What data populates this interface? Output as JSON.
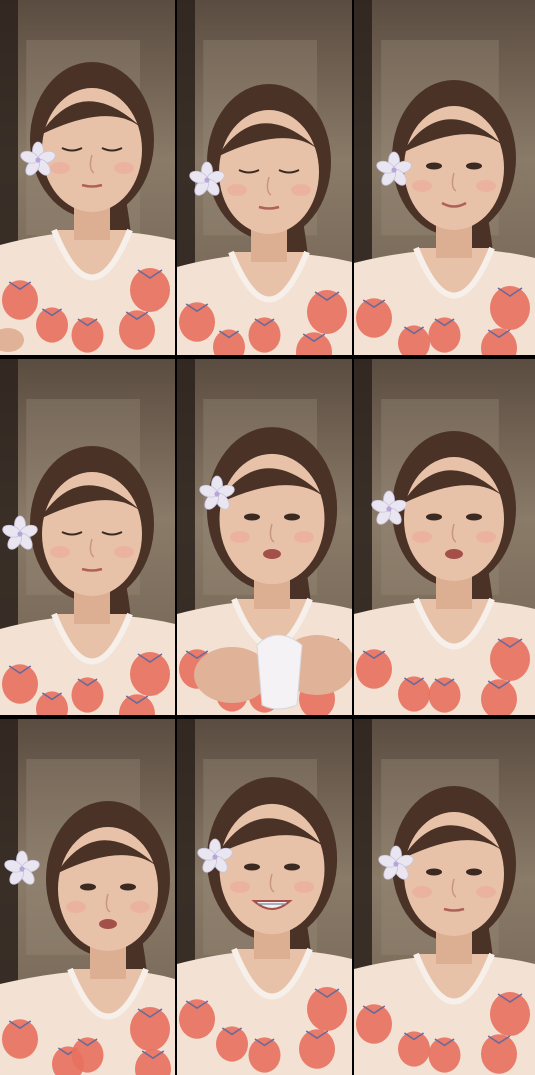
{
  "grid": {
    "rows": 3,
    "columns": 3,
    "frames": [
      {
        "label": "frame-1",
        "flower": true,
        "expression": "eyes-closed",
        "hands": "low"
      },
      {
        "label": "frame-2",
        "flower": true,
        "expression": "eyes-closed",
        "hands": "none"
      },
      {
        "label": "frame-3",
        "flower": true,
        "expression": "smile",
        "hands": "none"
      },
      {
        "label": "frame-4",
        "flower": true,
        "expression": "eyes-closed",
        "hands": "none"
      },
      {
        "label": "frame-5",
        "flower": true,
        "expression": "talking",
        "hands": "holding-tissue"
      },
      {
        "label": "frame-6",
        "flower": true,
        "expression": "talking",
        "hands": "none"
      },
      {
        "label": "frame-7",
        "flower": true,
        "expression": "talking",
        "hands": "none"
      },
      {
        "label": "frame-8",
        "flower": true,
        "expression": "grin-braces",
        "hands": "none"
      },
      {
        "label": "frame-9",
        "flower": true,
        "expression": "neutral",
        "hands": "none"
      }
    ]
  },
  "colors": {
    "background": "#000000",
    "wall": "#8a7a68",
    "skin": "#e8c2a8",
    "hair": "#4a3226",
    "shirt": "#f3e2d4",
    "strawberry": "#e8705e",
    "flower": "#e9e6f2"
  }
}
